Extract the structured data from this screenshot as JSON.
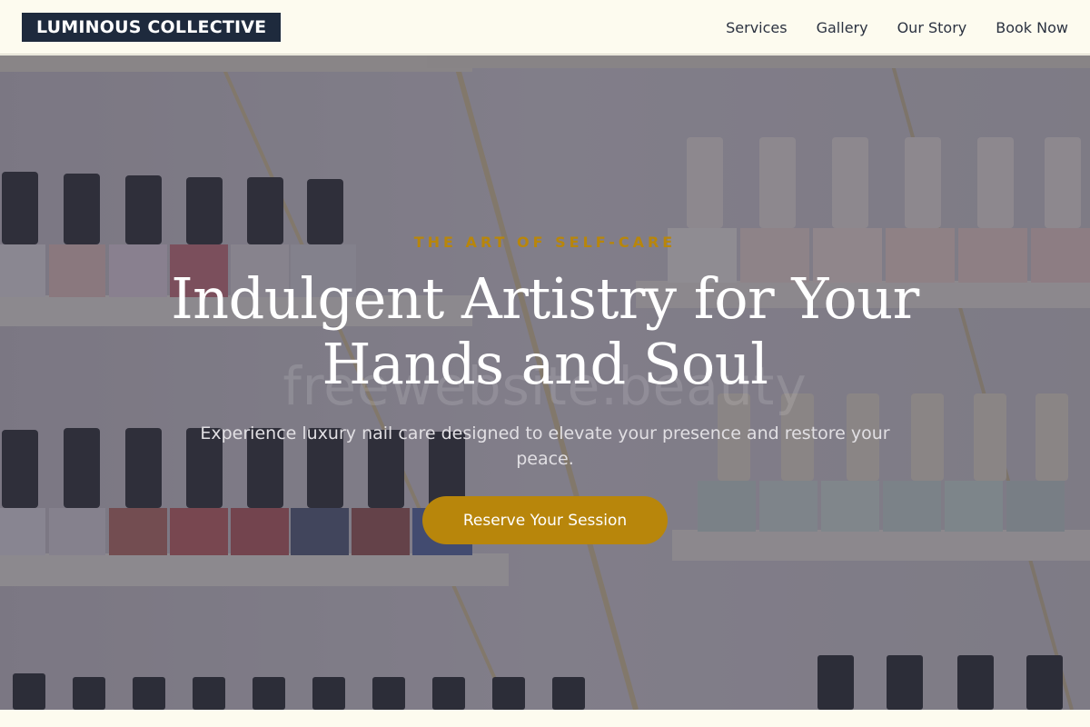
{
  "header": {
    "logo": "LUMINOUS COLLECTIVE",
    "nav": [
      "Services",
      "Gallery",
      "Our Story",
      "Book Now"
    ]
  },
  "hero": {
    "eyebrow": "THE ART OF SELF-CARE",
    "headline_line1": "Indulgent Artistry for Your",
    "headline_line2": "Hands and Soul",
    "watermark": "freewebsite.beauty",
    "subtext": "Experience luxury nail care designed to elevate your presence and restore your peace.",
    "cta": "Reserve Your Session",
    "background_image": "nail-polish-bottles-on-shelves"
  },
  "colors": {
    "accent": "#b8860b",
    "logo_bg": "#1e2a3d",
    "page_bg": "#fdfbef"
  }
}
